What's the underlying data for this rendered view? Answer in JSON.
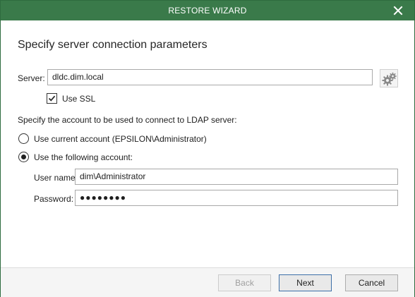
{
  "window": {
    "title": "RESTORE WIZARD",
    "accent_color": "#3a7a4a"
  },
  "page": {
    "heading": "Specify server connection parameters"
  },
  "server": {
    "label": "Server:",
    "value": "dldc.dim.local",
    "settings_icon": "gears-icon"
  },
  "ssl": {
    "label": "Use SSL",
    "checked": true
  },
  "account": {
    "prompt": "Specify the account to be used to connect to LDAP server:",
    "option_current": "Use current account (EPSILON\\Administrator)",
    "option_following": "Use the following account:",
    "selected": "following",
    "username_label": "User name:",
    "username_value": "dim\\Administrator",
    "password_label": "Password:",
    "password_mask": "●●●●●●●●"
  },
  "buttons": {
    "back": "Back",
    "next": "Next",
    "cancel": "Cancel"
  }
}
